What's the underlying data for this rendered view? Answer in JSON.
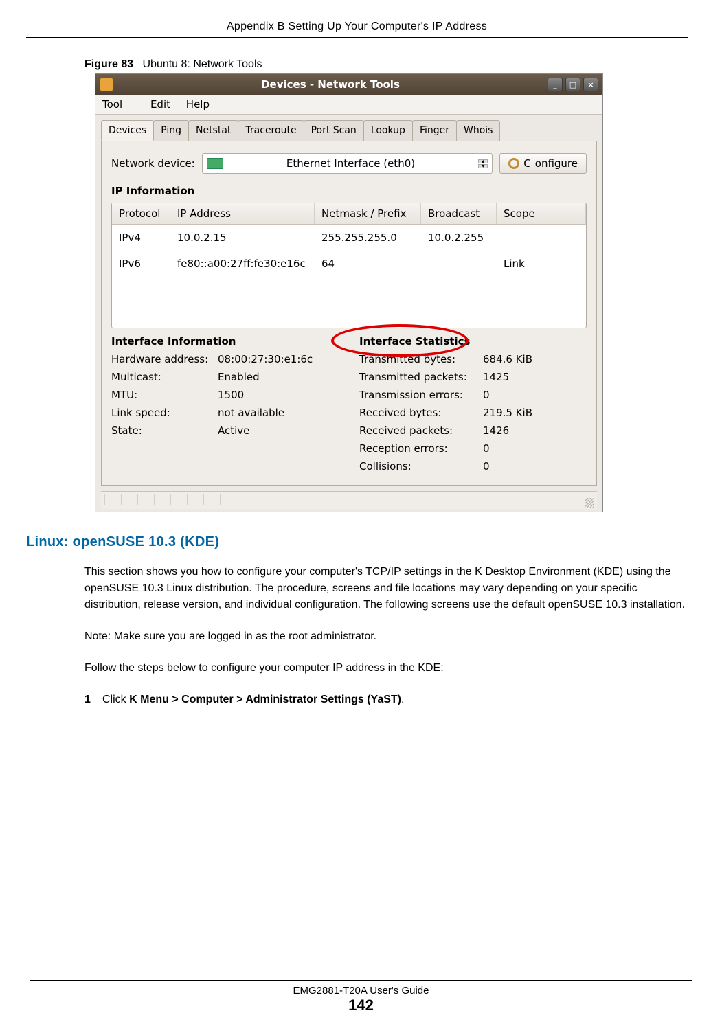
{
  "header": "Appendix B Setting Up Your Computer's IP Address",
  "figure": {
    "label": "Figure 83",
    "caption": "Ubuntu 8: Network Tools"
  },
  "window": {
    "title": "Devices - Network Tools",
    "menus": {
      "tool": "Tool",
      "edit": "Edit",
      "help": "Help"
    },
    "tabs": [
      "Devices",
      "Ping",
      "Netstat",
      "Traceroute",
      "Port Scan",
      "Lookup",
      "Finger",
      "Whois"
    ],
    "device": {
      "label": "Network device:",
      "selected": "Ethernet Interface (eth0)"
    },
    "configure_btn": "Configure",
    "ip_section": "IP Information",
    "ip_headers": {
      "protocol": "Protocol",
      "ip": "IP Address",
      "mask": "Netmask / Prefix",
      "broadcast": "Broadcast",
      "scope": "Scope"
    },
    "ip_rows": [
      {
        "protocol": "IPv4",
        "ip": "10.0.2.15",
        "mask": "255.255.255.0",
        "broadcast": "10.0.2.255",
        "scope": ""
      },
      {
        "protocol": "IPv6",
        "ip": "fe80::a00:27ff:fe30:e16c",
        "mask": "64",
        "broadcast": "",
        "scope": "Link"
      }
    ],
    "iface_info": {
      "heading": "Interface Information",
      "rows": [
        {
          "k": "Hardware address:",
          "v": "08:00:27:30:e1:6c"
        },
        {
          "k": "Multicast:",
          "v": "Enabled"
        },
        {
          "k": "MTU:",
          "v": "1500"
        },
        {
          "k": "Link speed:",
          "v": "not available"
        },
        {
          "k": "State:",
          "v": "Active"
        }
      ]
    },
    "iface_stats": {
      "heading": "Interface Statistics",
      "rows": [
        {
          "k": "Transmitted bytes:",
          "v": "684.6 KiB"
        },
        {
          "k": "Transmitted packets:",
          "v": "1425"
        },
        {
          "k": "Transmission errors:",
          "v": "0"
        },
        {
          "k": "Received bytes:",
          "v": "219.5 KiB"
        },
        {
          "k": "Received packets:",
          "v": "1426"
        },
        {
          "k": "Reception errors:",
          "v": "0"
        },
        {
          "k": "Collisions:",
          "v": "0"
        }
      ]
    }
  },
  "doc": {
    "h3": "Linux: openSUSE 10.3 (KDE)",
    "p1": "This section shows you how to configure your computer's TCP/IP settings in the K Desktop Environment (KDE) using the openSUSE 10.3 Linux distribution. The procedure, screens and file locations may vary depending on your specific distribution, release version, and individual configuration. The following screens use the default openSUSE 10.3 installation.",
    "note": "Note: Make sure you are logged in as the root administrator.",
    "p2": "Follow the steps below to configure your computer IP address in the KDE:",
    "step1_num": "1",
    "step1_pre": "Click ",
    "step1_bold": "K Menu > Computer > Administrator Settings (YaST)",
    "step1_post": "."
  },
  "footer": {
    "guide": "EMG2881-T20A User's Guide",
    "page": "142"
  }
}
